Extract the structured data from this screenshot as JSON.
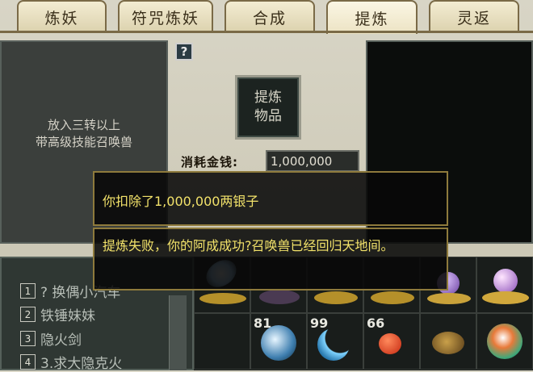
{
  "tabs": [
    "炼妖",
    "符咒炼妖",
    "合成",
    "提炼",
    "灵返"
  ],
  "active_tab": "提炼",
  "help_label": "?",
  "left_slot_hint": [
    "放入三转以上",
    "带高级技能召唤兽"
  ],
  "refine_button": [
    "提炼",
    "物品"
  ],
  "cost": {
    "label": "消耗金钱:",
    "value": "1,000,000"
  },
  "popups": [
    "你扣除了1,000,000两银子",
    "提炼失败，你的阿成成功?召唤兽已经回归天地间。"
  ],
  "pet_list": [
    {
      "num": "1",
      "name": "? 换偶小汽车"
    },
    {
      "num": "2",
      "name": "铁锤妹妹"
    },
    {
      "num": "3",
      "name": "隐火剑"
    },
    {
      "num": "4",
      "name": "3.求大隐克火"
    }
  ],
  "inventory_counts": {
    "slot_7": "81",
    "slot_8": "99",
    "slot_9": "66"
  },
  "colors": {
    "popup_text": "#f2e26a",
    "popup_border": "#8e7a3c"
  }
}
